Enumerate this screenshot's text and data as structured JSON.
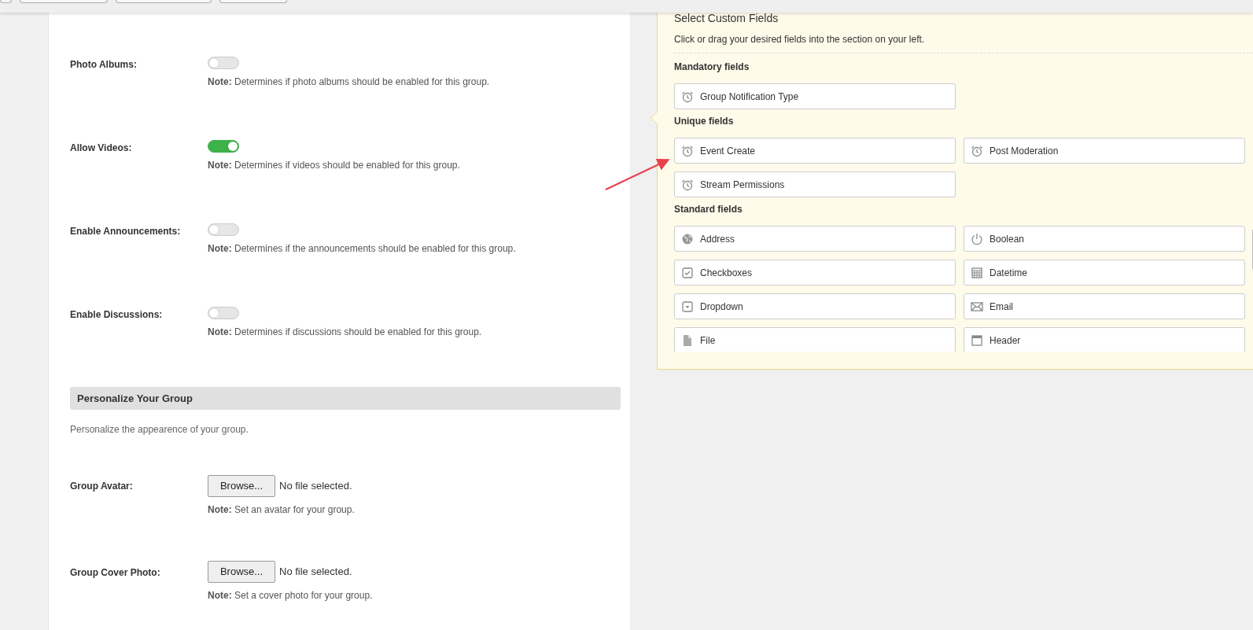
{
  "settings": [
    {
      "label": "Photo Albums:",
      "on": false,
      "note_label": "Note:",
      "note": "Determines if photo albums should be enabled for this group."
    },
    {
      "label": "Allow Videos:",
      "on": true,
      "note_label": "Note:",
      "note": "Determines if videos should be enabled for this group."
    },
    {
      "label": "Enable Announcements:",
      "on": false,
      "note_label": "Note:",
      "note": "Determines if the announcements should be enabled for this group."
    },
    {
      "label": "Enable Discussions:",
      "on": false,
      "note_label": "Note:",
      "note": "Determines if discussions should be enabled for this group."
    }
  ],
  "personalize": {
    "title": "Personalize Your Group",
    "description": "Personalize the appearence of your group.",
    "uploads": [
      {
        "label": "Group Avatar:",
        "button": "Browse...",
        "status": "No file selected.",
        "note_label": "Note:",
        "note": "Set an avatar for your group."
      },
      {
        "label": "Group Cover Photo:",
        "button": "Browse...",
        "status": "No file selected.",
        "note_label": "Note:",
        "note": "Set a cover photo for your group."
      }
    ]
  },
  "custom_fields": {
    "title": "Select Custom Fields",
    "description": "Click or drag your desired fields into the section on your left.",
    "groups": [
      {
        "title": "Mandatory fields",
        "fields": [
          {
            "label": "Group Notification Type",
            "kind": "alarm"
          }
        ]
      },
      {
        "title": "Unique fields",
        "fields": [
          {
            "label": "Event Create",
            "kind": "alarm"
          },
          {
            "label": "Post Moderation",
            "kind": "alarm"
          },
          {
            "label": "Stream Permissions",
            "kind": "alarm"
          }
        ]
      },
      {
        "title": "Standard fields",
        "scroll": true,
        "fields": [
          {
            "label": "Address",
            "kind": "globe"
          },
          {
            "label": "Boolean",
            "kind": "power"
          },
          {
            "label": "Checkboxes",
            "kind": "checkbox"
          },
          {
            "label": "Datetime",
            "kind": "calendar"
          },
          {
            "label": "Dropdown",
            "kind": "dropdown"
          },
          {
            "label": "Email",
            "kind": "envelope"
          },
          {
            "label": "File",
            "kind": "file"
          },
          {
            "label": "Header",
            "kind": "header"
          }
        ]
      }
    ]
  }
}
